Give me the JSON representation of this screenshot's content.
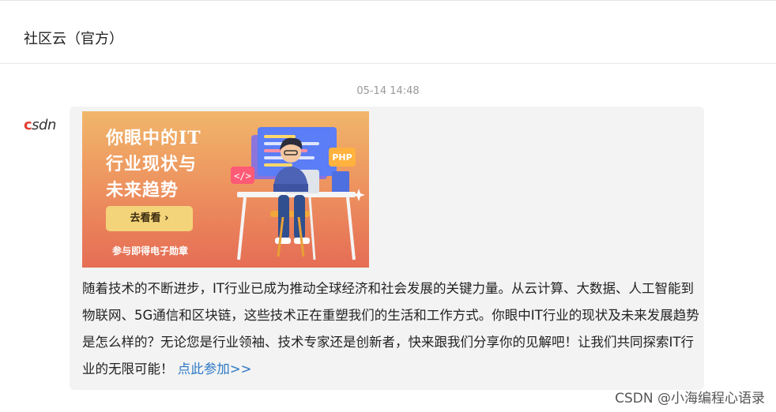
{
  "header": {
    "title": "社区云（官方）"
  },
  "message": {
    "timestamp": "05-14 14:48",
    "sender_avatar": "CSDN",
    "banner": {
      "headline_line1": "你眼中的IT",
      "headline_line2": "行业现状与",
      "headline_line3": "未来趋势",
      "button_label": "去看看",
      "button_icon": "chevron-right-icon",
      "subtext": "参与即得电子勋章",
      "badge_text": "PHP"
    },
    "body_text": "随着技术的不断进步，IT行业已成为推动全球经济和社会发展的关键力量。从云计算、大数据、人工智能到物联网、5G通信和区块链，这些技术正在重塑我们的生活和工作方式。你眼中IT行业的现状及未来发展趋势是怎么样的？无论您是行业领袖、技术专家还是创新者，快来跟我们分享你的见解吧！让我们共同探索IT行业的无限可能！",
    "link_text": "点此参加>>"
  },
  "watermark": "CSDN @小海编程心语录",
  "colors": {
    "link": "#2b78c5",
    "bubble_bg": "#f3f3f3",
    "banner_top": "#f0b66a",
    "banner_bottom": "#e56d55",
    "banner_button": "#f4d47a"
  }
}
